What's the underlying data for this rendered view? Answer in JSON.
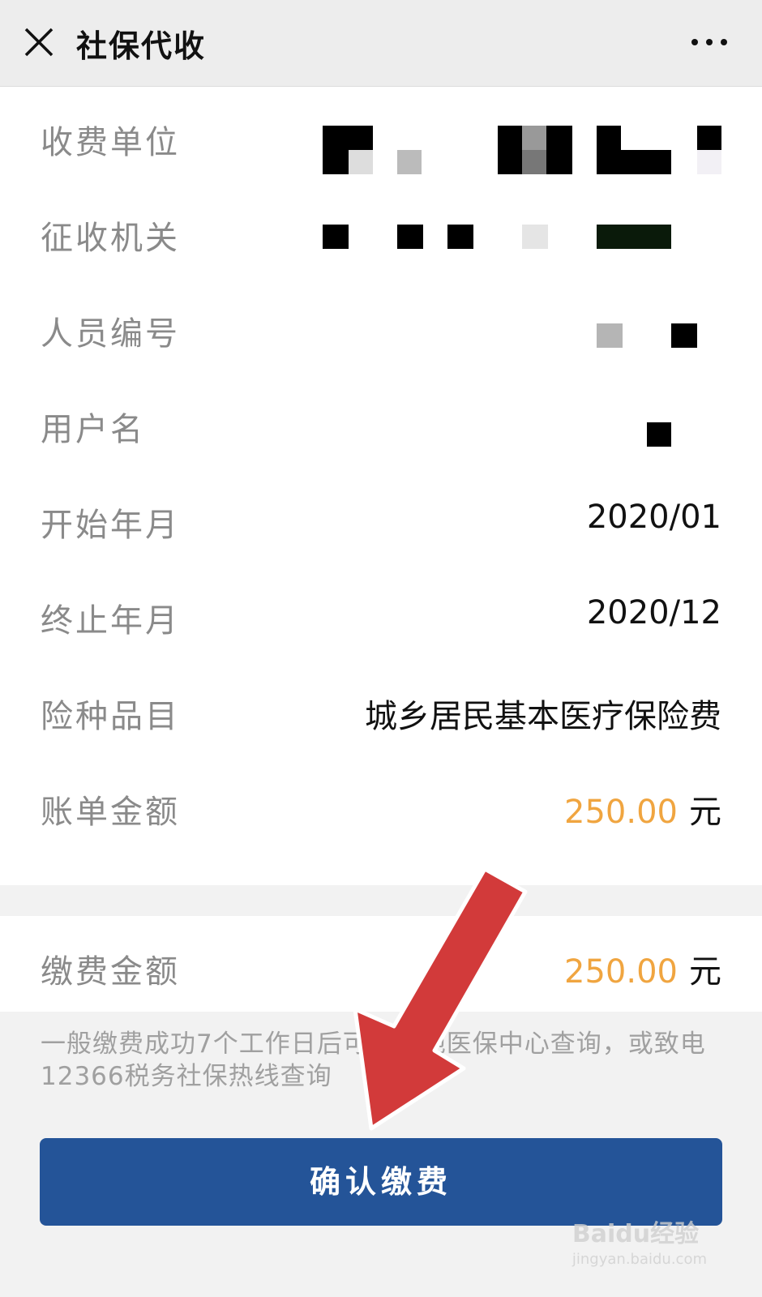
{
  "header": {
    "title": "社保代收",
    "close_icon": "close-icon",
    "more_icon": "more-dots-icon"
  },
  "rows": [
    {
      "label": "收费单位",
      "value": ""
    },
    {
      "label": "征收机关",
      "value": ""
    },
    {
      "label": "人员编号",
      "value": ""
    },
    {
      "label": "用户名",
      "value": ""
    },
    {
      "label": "开始年月",
      "value": "2020/01"
    },
    {
      "label": "终止年月",
      "value": "2020/12"
    },
    {
      "label": "险种品目",
      "value": "城乡居民基本医疗保险费"
    },
    {
      "label": "账单金额",
      "value": "250.00",
      "unit": "元"
    }
  ],
  "payment": {
    "label": "缴费金额",
    "value": "250.00",
    "unit": "元"
  },
  "note": "一般缴费成功7个工作日后可去当地医保中心查询，或致电12366税务社保热线查询",
  "confirm_button": "确认缴费",
  "colors": {
    "primary": "#245498",
    "amount": "#f0a540",
    "arrow": "#d23a3a"
  },
  "watermark": {
    "brand": "Baidu经验",
    "url": "jingyan.baidu.com"
  }
}
